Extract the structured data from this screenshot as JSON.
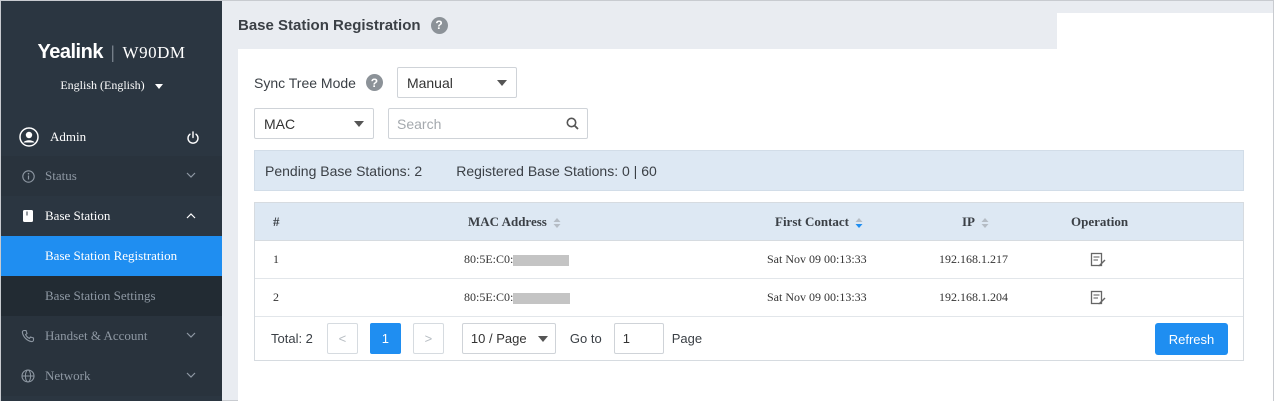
{
  "brand": {
    "logo": "Yealink",
    "model": "W90DM"
  },
  "language": {
    "selected": "English (English)"
  },
  "user": {
    "name": "Admin"
  },
  "nav": {
    "status": "Status",
    "base_station": "Base Station",
    "base_station_registration": "Base Station Registration",
    "base_station_settings": "Base Station Settings",
    "handset_account": "Handset & Account",
    "network": "Network"
  },
  "page": {
    "title": "Base Station Registration",
    "help": "?"
  },
  "sync": {
    "label": "Sync Tree Mode",
    "help": "?",
    "value": "Manual"
  },
  "filter": {
    "type": "MAC",
    "search_placeholder": "Search"
  },
  "summary": {
    "pending": "Pending Base Stations: 2",
    "registered": "Registered Base Stations: 0 | 60"
  },
  "table": {
    "headers": {
      "num": "#",
      "mac": "MAC Address",
      "first_contact": "First Contact",
      "ip": "IP",
      "operation": "Operation"
    },
    "rows": [
      {
        "num": "1",
        "mac": "80:5E:C0:",
        "first_contact": "Sat Nov 09 00:13:33",
        "ip": "192.168.1.217"
      },
      {
        "num": "2",
        "mac": "80:5E:C0:",
        "first_contact": "Sat Nov 09 00:13:33",
        "ip": "192.168.1.204"
      }
    ]
  },
  "pager": {
    "total": "Total: 2",
    "prev": "<",
    "current": "1",
    "next": ">",
    "page_size": "10 / Page",
    "goto_label": "Go to",
    "goto_value": "1",
    "page_label": "Page",
    "refresh": "Refresh"
  },
  "colors": {
    "accent": "#1f8ef1",
    "sidebar": "#2b3641",
    "header_bg": "#dde8f3"
  }
}
